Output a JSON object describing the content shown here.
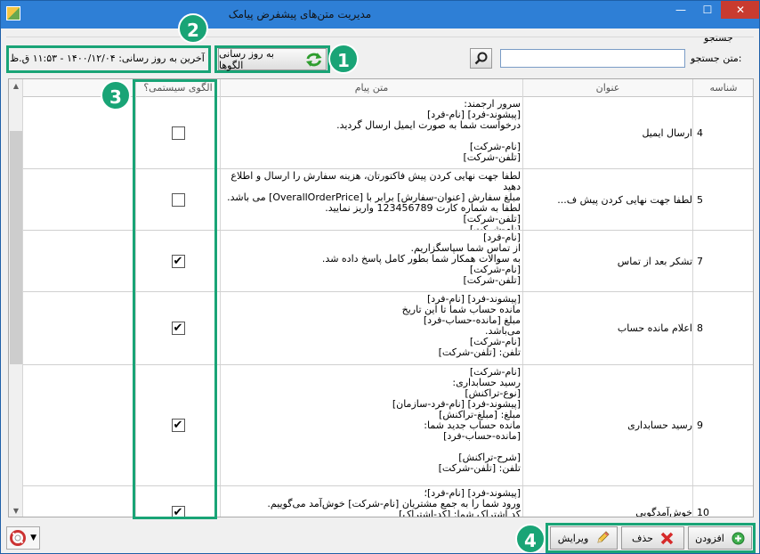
{
  "window": {
    "title": "مدیریت متن‌های پیشفرض پیامک",
    "minimize_glyph": "—",
    "maximize_glyph": "☐",
    "close_glyph": "✕"
  },
  "search": {
    "group_label": "جستجو",
    "field_label": "متن جستجو:",
    "value": "",
    "button_icon": "search-icon"
  },
  "toolbar": {
    "refresh_label": "به روز رسانی الگوها",
    "refresh_icon": "refresh-icon",
    "last_update_text": "آخرین به روز رسانی: ۱۴۰۰/۱۲/۰۴ - ۱۱:۵۳ ق.ظ"
  },
  "annotations": [
    "1",
    "2",
    "3",
    "4"
  ],
  "accent_color": "#19a476",
  "grid": {
    "columns": {
      "id": "شناسه",
      "title": "عنوان",
      "message": "متن پیام",
      "system": "الگوی سیستمی؟"
    },
    "rows": [
      {
        "id": "4",
        "title": "ارسال ایمیل",
        "message": "سرور ارجمند:\n[پیشوند-فرد] [نام-فرد]\nدرخواست شما به صورت ایمیل ارسال گردید.\n\n[نام-شرکت]\n[تلفن-شرکت]",
        "system": false
      },
      {
        "id": "5",
        "title": "لطفا جهت نهایی کردن پیش ف...",
        "message": "لطفا جهت نهایی کردن پیش فاکتورتان، هزینه سفارش را ارسال و اطلاع دهید\nمبلغ سفارش [عنوان-سفارش] برابر با [OverallOrderPrice] می باشد.\nلطفا به شماره کارت 123456789 واریز نمایید.\n[تلفن-شرکت]\n[نام-شرکت]",
        "system": false
      },
      {
        "id": "7",
        "title": "تشکر بعد از تماس",
        "message": "[نام-فرد]\nاز تماس شما سپاسگزاریم.\nبه سوالات همکار شما بطور کامل پاسخ داده شد.\n[نام-شرکت]\n[تلفن-شرکت]",
        "system": true
      },
      {
        "id": "8",
        "title": "اعلام مانده حساب",
        "message": "[پیشوند-فرد] [نام-فرد]\nمانده حساب شما تا این تاریخ\nمبلغ [مانده-حساب-فرد]\nمی‌باشد.\n[نام-شرکت]\nتلفن: [تلفن-شرکت]",
        "system": true
      },
      {
        "id": "9",
        "title": "رسید حسابداری",
        "message": "[نام-شرکت]\nرسید حسابداری:\n[نوع-تراکنش]\n[پیشوند-فرد] [نام-فرد-سازمان]\nمبلغ: [مبلغ-تراکنش]\nمانده حساب جدید شما:\n[مانده-حساب-فرد]\n\n[شرح-تراکنش]\nتلفن: [تلفن-شرکت]",
        "system": true
      },
      {
        "id": "10",
        "title": "خوش‌آمدگویی",
        "message": "[پیشوند-فرد] [نام-فرد]؛\nورود شما را به جمع مشتریان [نام-شرکت] خوش‌آمد می‌گوییم.\nکد اشتراک شما: [کد-اشتراک]",
        "system": true
      }
    ]
  },
  "footer": {
    "add_label": "افزودن",
    "add_icon": "plus-circle-icon",
    "delete_label": "حذف",
    "delete_icon": "red-x-icon",
    "edit_label": "ویرایش",
    "edit_icon": "pencil-icon",
    "help_icon": "lifebuoy-icon"
  }
}
